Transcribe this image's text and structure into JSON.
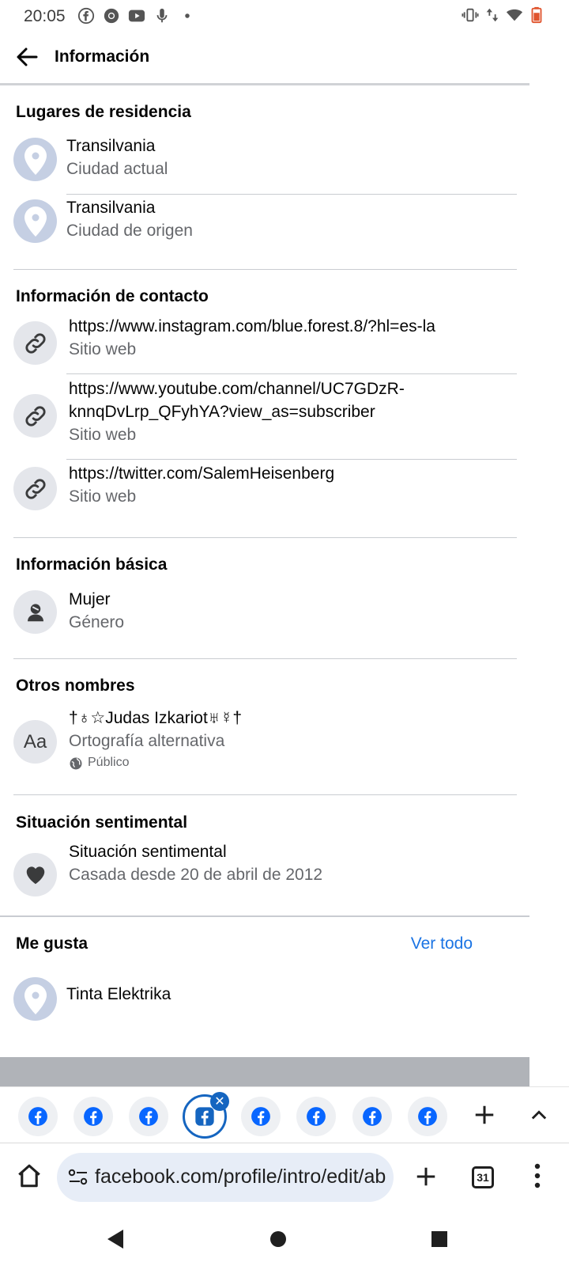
{
  "status_bar": {
    "time": "20:05",
    "left_icons": [
      "facebook-icon",
      "chrome-icon",
      "youtube-icon",
      "microphone-icon",
      "dot-icon"
    ],
    "right_icons": [
      "vibrate-icon",
      "data-arrows-icon",
      "wifi-icon",
      "battery-icon"
    ]
  },
  "header": {
    "title": "Información"
  },
  "sections": {
    "residence": {
      "title": "Lugares de residencia",
      "items": [
        {
          "primary": "Transilvania",
          "secondary": "Ciudad actual"
        },
        {
          "primary": "Transilvania",
          "secondary": "Ciudad de origen"
        }
      ]
    },
    "contact": {
      "title": "Información de contacto",
      "items": [
        {
          "primary": "https://www.instagram.com/blue.forest.8/?hl=es-la",
          "secondary": "Sitio web"
        },
        {
          "primary_line1": "https://www.youtube.com/channel/UC7GDzR-",
          "primary_line2": "knnqDvLrp_QFyhYA?view_as=subscriber",
          "secondary": "Sitio web"
        },
        {
          "primary": "https://twitter.com/SalemHeisenberg",
          "secondary": "Sitio web"
        }
      ]
    },
    "basic": {
      "title": "Información básica",
      "items": [
        {
          "primary": "Mujer",
          "secondary": "Género"
        }
      ]
    },
    "other_names": {
      "title": "Otros nombres",
      "items": [
        {
          "icon_text": "Aa",
          "primary": "†♁☆Judas Izkariot♅☿†",
          "secondary": "Ortografía alternativa",
          "privacy": "Público"
        }
      ]
    },
    "relationship": {
      "title": "Situación sentimental",
      "items": [
        {
          "primary": "Situación sentimental",
          "secondary": "Casada desde 20 de abril de 2012"
        }
      ]
    },
    "likes": {
      "title": "Me gusta",
      "see_all": "Ver todo",
      "items": [
        {
          "primary": "Tinta Elektrika"
        }
      ]
    }
  },
  "browser": {
    "tab_count": "31",
    "url": "facebook.com/profile/intro/edit/ab",
    "tab_close": "✕"
  },
  "colors": {
    "accent": "#1b74e4",
    "facebook_blue": "#0866ff",
    "secondary_text": "#65676b",
    "active_tab_border": "#1565c0"
  }
}
